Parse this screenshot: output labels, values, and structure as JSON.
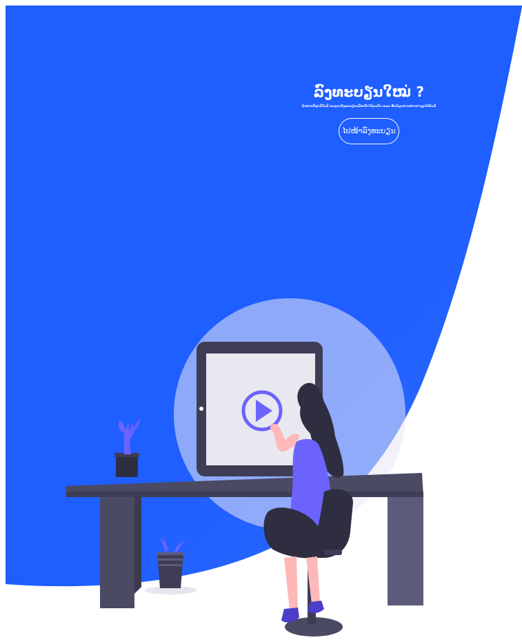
{
  "signup_panel": {
    "title": "ລົງທະບຽນໃໝ່ ?",
    "description": "ຖ້າທ່ານຍັງບໍ່ມີບັນຊີ ກະລຸນາລົງທະບຽນເພື່ອເຂົ້າໃຊ້ລະບົບ ແລະ ຮັບຂໍ້ມູນຂ່າວສານຕ່າງໆໄດ້ທັນທີ",
    "button_label": "ໄປໜ້າລົງທະບຽນ"
  },
  "colors": {
    "panel_blue": "#1f5eff",
    "panel_blue_light": "#4c7dff",
    "desk": "#4b4a63",
    "monitor": "#3f3d56",
    "screen": "#e8e8f0",
    "accent_purple": "#6c63ff",
    "hair": "#2f2e41",
    "skin": "#ffb8b8",
    "background": "#ffffff"
  },
  "illustration": {
    "icons": [
      "play-icon",
      "cactus-plant-icon",
      "potted-plant-icon"
    ]
  }
}
